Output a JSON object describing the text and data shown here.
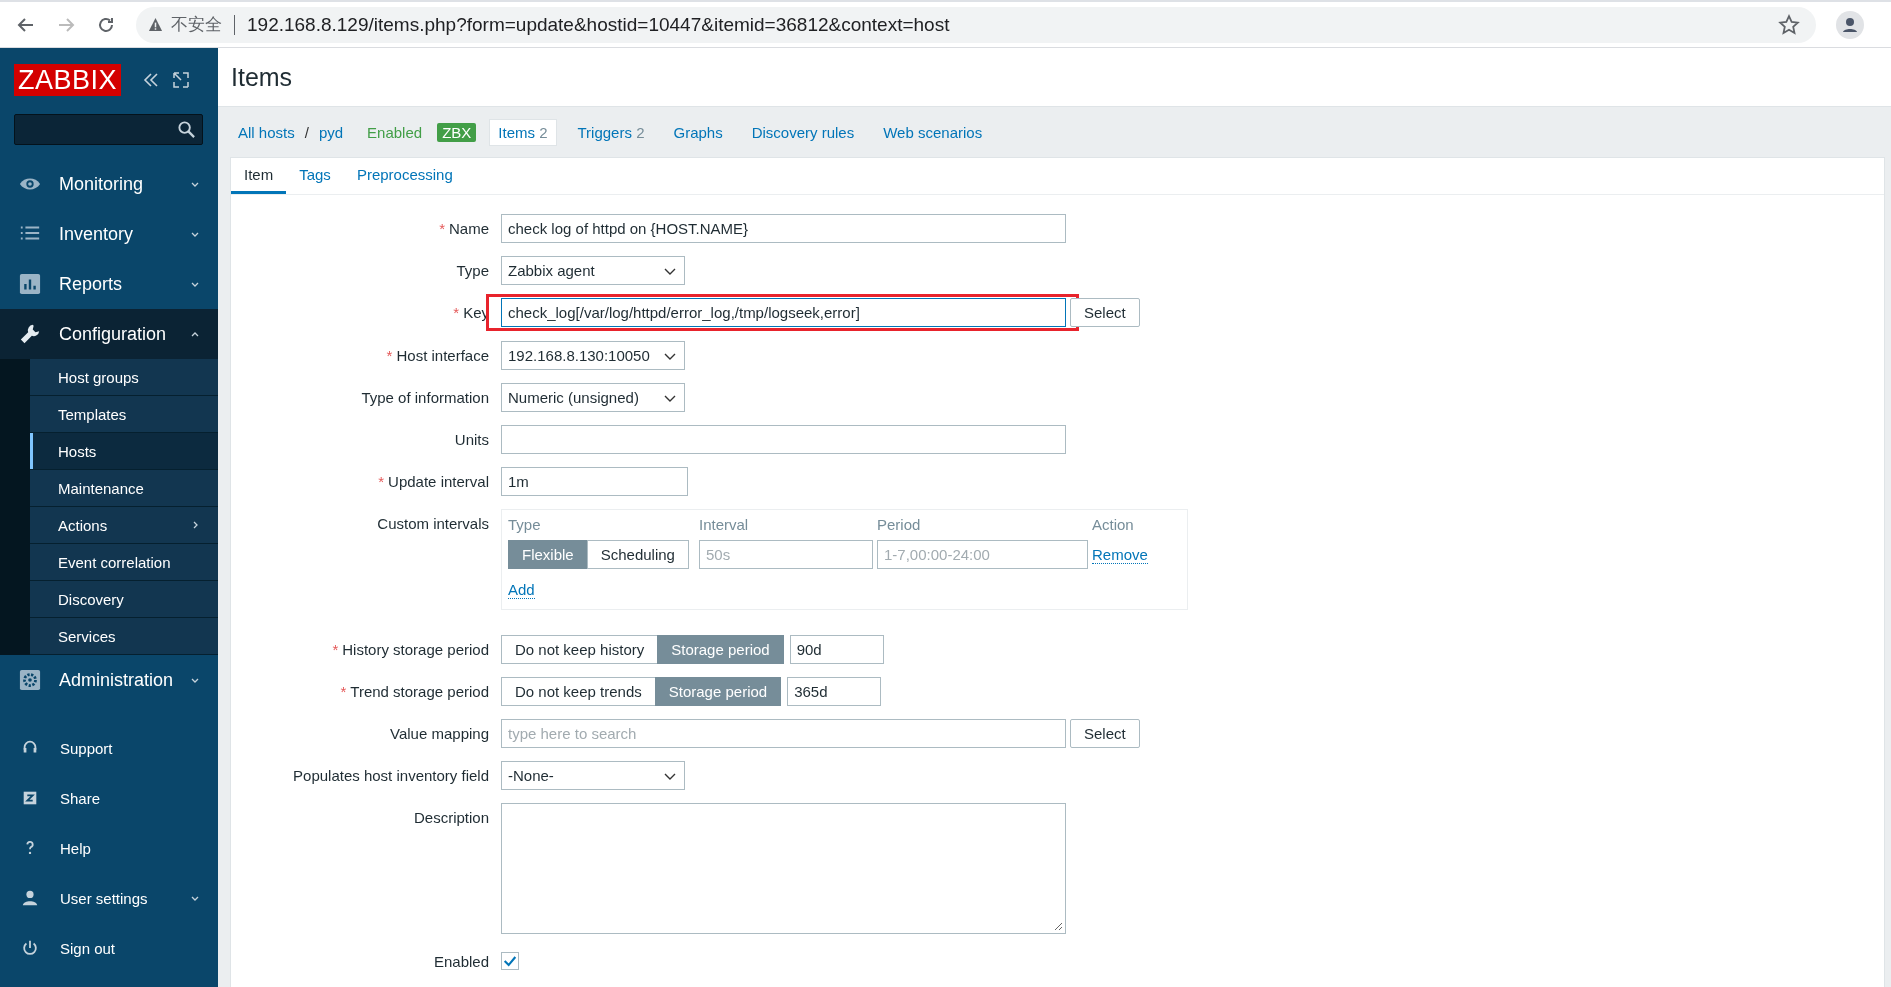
{
  "browser": {
    "security": "不安全",
    "url": "192.168.8.129/items.php?form=update&hostid=10447&itemid=36812&context=host"
  },
  "sidebar": {
    "logo": "ZABBIX",
    "menu": [
      {
        "label": "Monitoring",
        "kind": "eye",
        "expanded": false
      },
      {
        "label": "Inventory",
        "kind": "list",
        "expanded": false
      },
      {
        "label": "Reports",
        "kind": "chart",
        "expanded": false
      },
      {
        "label": "Configuration",
        "kind": "wrench",
        "expanded": true,
        "children": [
          {
            "label": "Host groups",
            "selected": false,
            "submenu": false
          },
          {
            "label": "Templates",
            "selected": false,
            "submenu": false
          },
          {
            "label": "Hosts",
            "selected": true,
            "submenu": false
          },
          {
            "label": "Maintenance",
            "selected": false,
            "submenu": false
          },
          {
            "label": "Actions",
            "selected": false,
            "submenu": true
          },
          {
            "label": "Event correlation",
            "selected": false,
            "submenu": false
          },
          {
            "label": "Discovery",
            "selected": false,
            "submenu": false
          },
          {
            "label": "Services",
            "selected": false,
            "submenu": false
          }
        ]
      },
      {
        "label": "Administration",
        "kind": "gear",
        "expanded": false
      }
    ],
    "user_menu": [
      {
        "label": "Support",
        "kind": "headset",
        "expandable": false
      },
      {
        "label": "Share",
        "kind": "share",
        "expandable": false
      },
      {
        "label": "Help",
        "kind": "help",
        "expandable": false
      },
      {
        "label": "User settings",
        "kind": "user",
        "expandable": true
      },
      {
        "label": "Sign out",
        "kind": "power",
        "expandable": false
      }
    ]
  },
  "page_title": "Items",
  "required_mark": "*",
  "host_nav": {
    "breadcrumbs": [
      "All hosts",
      "pyd"
    ],
    "separator": "/",
    "status": "Enabled",
    "badge": "ZBX",
    "tabs": [
      {
        "label": "Items",
        "count": "2",
        "selected": true
      },
      {
        "label": "Triggers",
        "count": "2",
        "selected": false
      },
      {
        "label": "Graphs",
        "selected": false
      },
      {
        "label": "Discovery rules",
        "selected": false
      },
      {
        "label": "Web scenarios",
        "selected": false
      }
    ]
  },
  "form_tabs": [
    {
      "label": "Item",
      "selected": true
    },
    {
      "label": "Tags",
      "selected": false
    },
    {
      "label": "Preprocessing",
      "selected": false
    }
  ],
  "rows": [
    {
      "kind": "text",
      "label": "Name",
      "required": true,
      "value": "check log of httpd on {HOST.NAME}"
    },
    {
      "kind": "select",
      "label": "Type",
      "required": false,
      "value": "Zabbix agent"
    },
    {
      "kind": "key",
      "label": "Key",
      "required": true,
      "value": "check_log[/var/log/httpd/error_log,/tmp/logseek,error]",
      "button": "Select",
      "highlighted": true
    },
    {
      "kind": "select",
      "label": "Host interface",
      "required": true,
      "value": "192.168.8.130:10050"
    },
    {
      "kind": "select",
      "label": "Type of information",
      "required": false,
      "value": "Numeric (unsigned)"
    },
    {
      "kind": "text",
      "label": "Units",
      "required": false
    },
    {
      "kind": "short",
      "label": "Update interval",
      "required": true,
      "value": "1m"
    },
    {
      "kind": "intervals",
      "label": "Custom intervals",
      "required": false,
      "columns": [
        "Type",
        "Interval",
        "Period",
        "Action"
      ],
      "entries": [
        {
          "modes": [
            {
              "label": "Flexible",
              "selected": true
            },
            {
              "label": "Scheduling",
              "selected": false
            }
          ],
          "interval_placeholder": "50s",
          "period_placeholder": "1-7,00:00-24:00",
          "action": "Remove"
        }
      ],
      "add": "Add"
    },
    {
      "kind": "storage",
      "label": "History storage period",
      "required": true,
      "options": [
        {
          "label": "Do not keep history",
          "selected": false
        },
        {
          "label": "Storage period",
          "selected": true
        }
      ],
      "value": "90d"
    },
    {
      "kind": "storage",
      "label": "Trend storage period",
      "required": true,
      "options": [
        {
          "label": "Do not keep trends",
          "selected": false
        },
        {
          "label": "Storage period",
          "selected": true
        }
      ],
      "value": "365d"
    },
    {
      "kind": "lookup",
      "label": "Value mapping",
      "required": false,
      "placeholder": "type here to search",
      "button": "Select"
    },
    {
      "kind": "select",
      "label": "Populates host inventory field",
      "required": false,
      "value": "-None-"
    },
    {
      "kind": "textarea",
      "label": "Description",
      "required": false
    },
    {
      "kind": "checkbox",
      "label": "Enabled",
      "required": false,
      "checked": true
    }
  ]
}
